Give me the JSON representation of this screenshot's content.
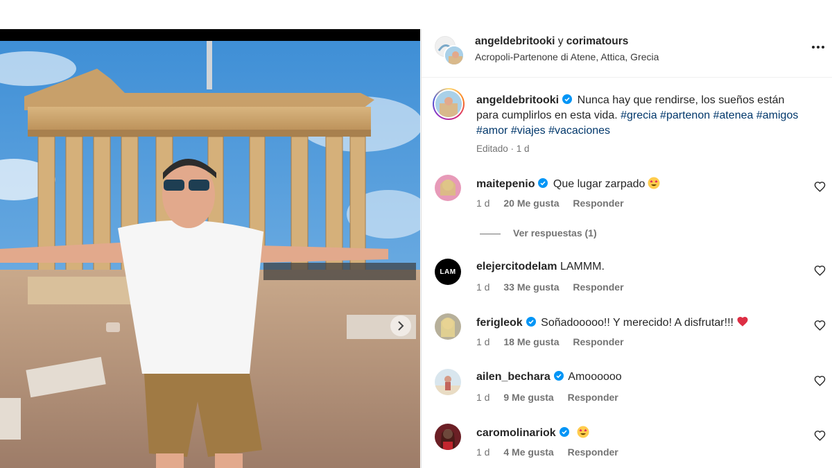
{
  "post": {
    "header": {
      "author": "angeldebritooki",
      "connector": "y",
      "coauthor": "corimatours",
      "location": "Acropoli-Partenone di Atene, Attica, Grecia"
    },
    "caption": {
      "username": "angeldebritooki",
      "text": "Nunca hay que rendirse, los sueños están para cumplirlos en esta vida.",
      "hashtags": [
        "#grecia",
        "#partenon",
        "#atenea",
        "#amigos",
        "#amor",
        "#viajes",
        "#vacaciones"
      ],
      "meta": "Editado · 1 d"
    },
    "view_replies": "Ver respuestas (1)",
    "comments": [
      {
        "username": "maitepenio",
        "verified": true,
        "text": "Que lugar zarpado",
        "emoji": "star-struck",
        "age": "1 d",
        "likes": "20 Me gusta",
        "reply": "Responder"
      },
      {
        "username": "elejercitodelam",
        "verified": false,
        "text": "LAMMM.",
        "emoji": "",
        "age": "1 d",
        "likes": "33 Me gusta",
        "reply": "Responder",
        "avatar_text": "LAM"
      },
      {
        "username": "ferigleok",
        "verified": true,
        "text": "Soñadooooo!! Y merecido! A disfrutar!!!",
        "emoji": "red-heart",
        "age": "1 d",
        "likes": "18 Me gusta",
        "reply": "Responder"
      },
      {
        "username": "ailen_bechara",
        "verified": true,
        "text": "Amoooooo",
        "emoji": "",
        "age": "1 d",
        "likes": "9 Me gusta",
        "reply": "Responder"
      },
      {
        "username": "caromolinariok",
        "verified": true,
        "text": "",
        "emoji": "star-struck",
        "age": "1 d",
        "likes": "4 Me gusta",
        "reply": "Responder"
      }
    ]
  },
  "colors": {
    "verified_blue": "#0095f6",
    "hashtag": "#00376b",
    "muted": "#737373",
    "text": "#262626"
  },
  "icons": [
    "more-icon",
    "verified-icon",
    "heart-icon",
    "chevron-right-icon",
    "star-struck-emoji",
    "red-heart-emoji"
  ]
}
